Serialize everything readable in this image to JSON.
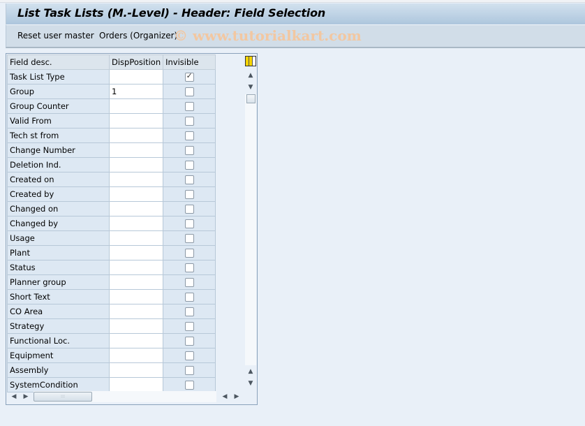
{
  "title": "List Task Lists (M.-Level) - Header: Field Selection",
  "toolbar": {
    "reset_label": "Reset user master",
    "orders_label": "Orders (Organizer)",
    "watermark": "© www.tutorialkart.com"
  },
  "grid": {
    "columns": [
      "Field desc.",
      "DispPosition",
      "Invisible"
    ],
    "rows": [
      {
        "desc": "Task List Type",
        "pos": "",
        "invisible": true
      },
      {
        "desc": "Group",
        "pos": "1",
        "invisible": false
      },
      {
        "desc": "Group Counter",
        "pos": "",
        "invisible": false
      },
      {
        "desc": "Valid From",
        "pos": "",
        "invisible": false
      },
      {
        "desc": "Tech st from",
        "pos": "",
        "invisible": false
      },
      {
        "desc": "Change Number",
        "pos": "",
        "invisible": false
      },
      {
        "desc": "Deletion Ind.",
        "pos": "",
        "invisible": false
      },
      {
        "desc": "Created on",
        "pos": "",
        "invisible": false
      },
      {
        "desc": "Created by",
        "pos": "",
        "invisible": false
      },
      {
        "desc": "Changed on",
        "pos": "",
        "invisible": false
      },
      {
        "desc": "Changed by",
        "pos": "",
        "invisible": false
      },
      {
        "desc": "Usage",
        "pos": "",
        "invisible": false
      },
      {
        "desc": "Plant",
        "pos": "",
        "invisible": false
      },
      {
        "desc": "Status",
        "pos": "",
        "invisible": false
      },
      {
        "desc": "Planner group",
        "pos": "",
        "invisible": false
      },
      {
        "desc": "Short Text",
        "pos": "",
        "invisible": false
      },
      {
        "desc": "CO Area",
        "pos": "",
        "invisible": false
      },
      {
        "desc": "Strategy",
        "pos": "",
        "invisible": false
      },
      {
        "desc": "Functional Loc.",
        "pos": "",
        "invisible": false
      },
      {
        "desc": "Equipment",
        "pos": "",
        "invisible": false
      },
      {
        "desc": "Assembly",
        "pos": "",
        "invisible": false
      },
      {
        "desc": "SystemCondition",
        "pos": "",
        "invisible": false
      }
    ]
  },
  "icons": {
    "scroll_up": "▲",
    "scroll_down": "▼",
    "scroll_left": "◀",
    "scroll_right": "▶",
    "check": "✓",
    "grip": ":::"
  }
}
